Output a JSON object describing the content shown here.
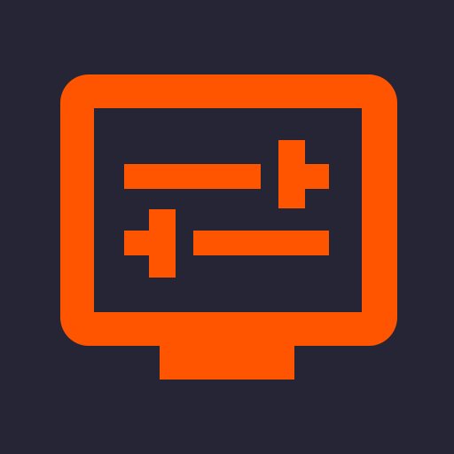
{
  "icon": {
    "name": "monitor-settings-icon",
    "background_color": "#252536",
    "accent_color": "#FF5500",
    "elements": [
      "monitor-frame",
      "monitor-stand",
      "slider-top",
      "slider-bottom"
    ]
  }
}
